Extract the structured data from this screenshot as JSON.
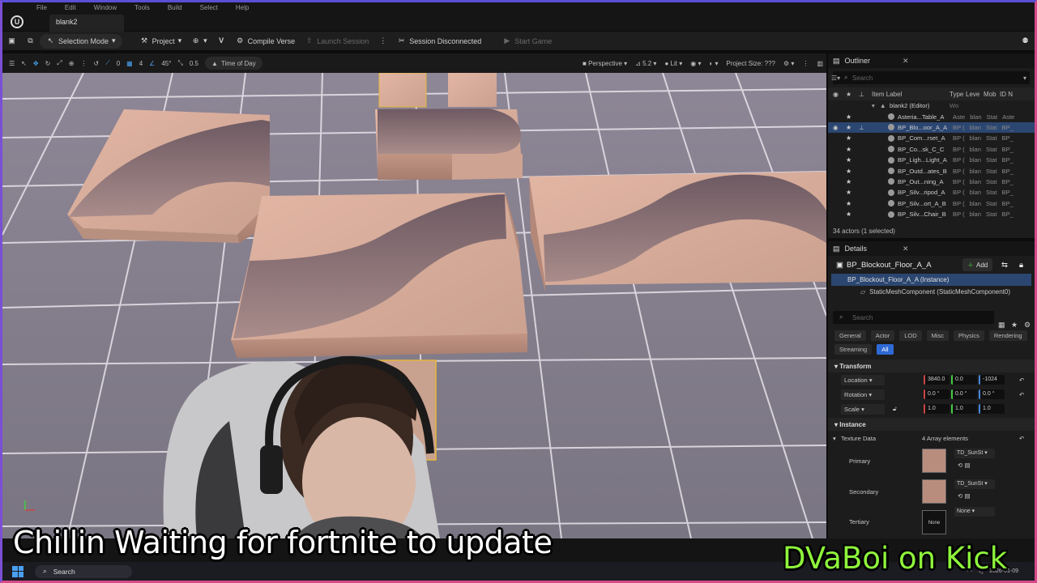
{
  "menubar": [
    "File",
    "Edit",
    "Window",
    "Tools",
    "Build",
    "Select",
    "Help"
  ],
  "window": {
    "tab_title": "blank2",
    "logo": "U"
  },
  "toolbar": {
    "selection_mode": "Selection Mode",
    "project": "Project",
    "compile": "Compile Verse",
    "launch": "Launch Session",
    "session": "Session Disconnected",
    "start": "Start Game"
  },
  "viewport_toolbar": {
    "rot_snap": "0",
    "grid_snap": "4",
    "angle_snap": "45°",
    "scale_snap": "0.5",
    "time_of_day": "Time of Day",
    "perspective": "Perspective",
    "speed": "5.2",
    "lit": "Lit",
    "project_size": "Project Size: ???"
  },
  "outliner": {
    "title": "Outliner",
    "search_placeholder": "Search",
    "col_label": "Item Label",
    "col_type": "Type",
    "col_level": "Leve",
    "col_mob": "Mob",
    "col_id": "ID N",
    "root": "blank2 (Editor)",
    "root_type": "Wo",
    "rows": [
      {
        "label": "Asteria...Table_A",
        "c1": "Aste",
        "c2": "blan",
        "c3": "Stat",
        "c4": "Aste",
        "selected": false
      },
      {
        "label": "BP_Blo...oor_A_A",
        "c1": "BP (",
        "c2": "blan",
        "c3": "Stat",
        "c4": "BP_",
        "selected": true
      },
      {
        "label": "BP_Com...rset_A",
        "c1": "BP (",
        "c2": "blan",
        "c3": "Stat",
        "c4": "BP_",
        "selected": false
      },
      {
        "label": "BP_Co...sk_C_C",
        "c1": "BP (",
        "c2": "blan",
        "c3": "Stat",
        "c4": "BP_",
        "selected": false
      },
      {
        "label": "BP_Ligh...Light_A",
        "c1": "BP (",
        "c2": "blan",
        "c3": "Stat",
        "c4": "BP_",
        "selected": false
      },
      {
        "label": "BP_Outd...ates_B",
        "c1": "BP (",
        "c2": "blan",
        "c3": "Stat",
        "c4": "BP_",
        "selected": false
      },
      {
        "label": "BP_Out...ning_A",
        "c1": "BP (",
        "c2": "blan",
        "c3": "Stat",
        "c4": "BP_",
        "selected": false
      },
      {
        "label": "BP_Silv...ripod_A",
        "c1": "BP (",
        "c2": "blan",
        "c3": "Stat",
        "c4": "BP_",
        "selected": false
      },
      {
        "label": "BP_Silv...ort_A_B",
        "c1": "BP (",
        "c2": "blan",
        "c3": "Stat",
        "c4": "BP_",
        "selected": false
      },
      {
        "label": "BP_Silv...Chair_B",
        "c1": "BP (",
        "c2": "blan",
        "c3": "Stat",
        "c4": "BP_",
        "selected": false
      }
    ],
    "footer": "34 actors (1 selected)"
  },
  "details": {
    "title": "Details",
    "actor_name": "BP_Blockout_Floor_A_A",
    "add_label": "Add",
    "instance": "BP_Blockout_Floor_A_A (Instance)",
    "component": "StaticMeshComponent (StaticMeshComponent0)",
    "search_placeholder": "Search",
    "filters": [
      "General",
      "Actor",
      "LOD",
      "Misc",
      "Physics",
      "Rendering",
      "Streaming",
      "All"
    ],
    "transform_header": "Transform",
    "location_label": "Location",
    "location": [
      "3840.0",
      "0.0",
      "-1024"
    ],
    "rotation_label": "Rotation",
    "rotation": [
      "0.0 °",
      "0.0 °",
      "0.0 °"
    ],
    "scale_label": "Scale",
    "scale": [
      "1.0",
      "1.0",
      "1.0"
    ],
    "instance_header": "Instance",
    "texture_data_label": "Texture Data",
    "texture_data_value": "4 Array elements",
    "primary_label": "Primary",
    "primary_tex": "TD_SunSt",
    "secondary_label": "Secondary",
    "secondary_tex": "TD_SunSt",
    "tertiary_label": "Tertiary",
    "tertiary_tex": "None",
    "tertiary_thumb": "None"
  },
  "overlay": {
    "caption": "Chillin Waiting for fortnite to update",
    "kick": "DVaBoi on Kick"
  },
  "taskbar": {
    "search": "Search",
    "date": "2026-01-09"
  }
}
